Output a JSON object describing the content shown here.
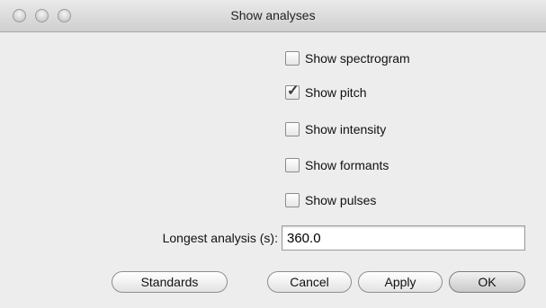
{
  "window": {
    "title": "Show analyses"
  },
  "checkboxes": [
    {
      "label": "Show spectrogram",
      "checked": false
    },
    {
      "label": "Show pitch",
      "checked": true
    },
    {
      "label": "Show intensity",
      "checked": false
    },
    {
      "label": "Show formants",
      "checked": false
    },
    {
      "label": "Show pulses",
      "checked": false
    }
  ],
  "longest_analysis": {
    "label": "Longest analysis (s):",
    "value": "360.0"
  },
  "buttons": {
    "standards": "Standards",
    "cancel": "Cancel",
    "apply": "Apply",
    "ok": "OK"
  },
  "icons": {
    "check_mark": "✓"
  }
}
